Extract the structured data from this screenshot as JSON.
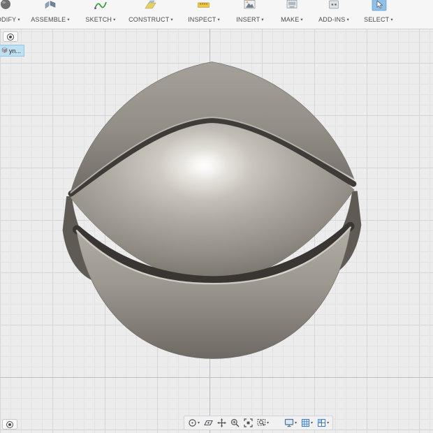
{
  "ui": {
    "caret": "▾"
  },
  "top_toolbar": {
    "items": [
      {
        "id": "modify",
        "label": "MODIFY",
        "icon": "modify-icon"
      },
      {
        "id": "assemble",
        "label": "ASSEMBLE",
        "icon": "assemble-icon"
      },
      {
        "id": "sketch",
        "label": "SKETCH",
        "icon": "sketch-icon"
      },
      {
        "id": "construct",
        "label": "CONSTRUCT",
        "icon": "construct-icon"
      },
      {
        "id": "inspect",
        "label": "INSPECT",
        "icon": "inspect-icon"
      },
      {
        "id": "insert",
        "label": "INSERT",
        "icon": "insert-icon"
      },
      {
        "id": "make",
        "label": "MAKE",
        "icon": "make-icon"
      },
      {
        "id": "add_ins",
        "label": "ADD-INS",
        "icon": "add-ins-icon"
      },
      {
        "id": "select",
        "label": "SELECT",
        "icon": "select-cursor-icon",
        "active": true
      }
    ]
  },
  "browser_panel": {
    "selected_item_label": "yn...",
    "selected_item_icon": "body-cube-icon"
  },
  "view_toolbar": {
    "buttons": [
      {
        "name": "orbit",
        "dropdown": true
      },
      {
        "name": "look-at",
        "dropdown": false
      },
      {
        "name": "pan",
        "dropdown": false
      },
      {
        "name": "zoom",
        "dropdown": false
      },
      {
        "name": "fit-view",
        "dropdown": false
      },
      {
        "name": "zoom-window",
        "dropdown": true
      },
      {
        "name": "display-settings",
        "dropdown": true
      },
      {
        "name": "grid-and-snaps",
        "dropdown": true
      },
      {
        "name": "viewports",
        "dropdown": true
      }
    ]
  },
  "colors": {
    "selection_blue": "#bfe0f3",
    "select_icon_blue": "#8ec0e8",
    "viewport_bg": "#ececec",
    "grid_minor": "#e1e2e4",
    "grid_major": "#d3d5d9",
    "model_highlight": "#f7f5f1",
    "model_mid": "#a8a29a",
    "model_dark": "#3e3b38"
  }
}
